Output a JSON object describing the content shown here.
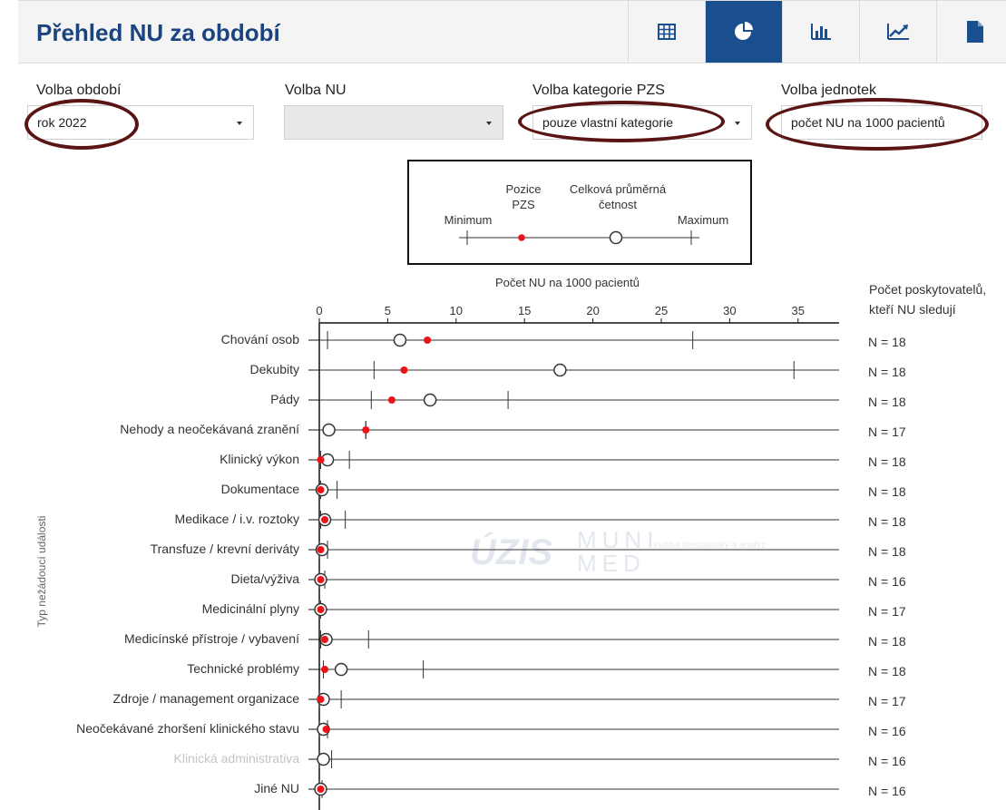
{
  "header": {
    "title": "Přehled NU za období",
    "views": [
      {
        "icon": "table-icon",
        "active": false
      },
      {
        "icon": "pie-chart-icon",
        "active": true
      },
      {
        "icon": "bar-chart-icon",
        "active": false
      },
      {
        "icon": "line-chart-icon",
        "active": false
      },
      {
        "icon": "document-icon",
        "active": false
      }
    ]
  },
  "filters": {
    "period": {
      "label": "Volba období",
      "value": "rok 2022"
    },
    "nu": {
      "label": "Volba NU",
      "value": ""
    },
    "category": {
      "label": "Volba kategorie PZS",
      "value": "pouze vlastní kategorie"
    },
    "units": {
      "label": "Volba jednotek",
      "value": "počet NU na 1000 pacientů"
    }
  },
  "legend": {
    "minimum": "Minimum",
    "position_line1": "Pozice",
    "position_line2": "PZS",
    "average_line1": "Celková průměrná",
    "average_line2": "četnost",
    "maximum": "Maximum"
  },
  "colors": {
    "accent": "#1a4f8f",
    "title": "#1a4480",
    "marker": "#e8141a",
    "highlight": "#5a1414"
  },
  "watermark": {
    "text1": "ÚZIS",
    "text2_line1": "MUNI",
    "text2_line2": "MED",
    "text3": "Institut biostatistiky a analýz"
  },
  "chart_data": {
    "type": "dot-range",
    "title": "Počet NU na 1000 pacientů",
    "ylabel": "Typ nežádoucí události",
    "right_title_line1": "Počet poskytovatelů,",
    "right_title_line2": "kteří NU sledují",
    "xlim": [
      0,
      38
    ],
    "xticks": [
      0,
      5,
      10,
      15,
      20,
      25,
      30,
      35
    ],
    "categories": [
      {
        "label": "Chování osob",
        "min": 0.6,
        "max": 27.3,
        "avg": 5.9,
        "pzs": 7.9,
        "n": "N = 18",
        "muted": false
      },
      {
        "label": "Dekubity",
        "min": 4.0,
        "max": 34.7,
        "avg": 17.6,
        "pzs": 6.2,
        "n": "N = 18",
        "muted": false
      },
      {
        "label": "Pády",
        "min": 3.8,
        "max": 13.8,
        "avg": 8.1,
        "pzs": 5.3,
        "n": "N = 18",
        "muted": false
      },
      {
        "label": "Nehody a neočekávaná zranění",
        "min": 3.4,
        "max": 3.4,
        "avg": 0.7,
        "pzs": 3.4,
        "n": "N = 17",
        "muted": false
      },
      {
        "label": "Klinický výkon",
        "min": 0.1,
        "max": 2.2,
        "avg": 0.6,
        "pzs": 0.1,
        "n": "N = 18",
        "muted": false
      },
      {
        "label": "Dokumentace",
        "min": 0.1,
        "max": 1.3,
        "avg": 0.2,
        "pzs": 0.1,
        "n": "N = 18",
        "muted": false
      },
      {
        "label": "Medikace / i.v. roztoky",
        "min": 0.1,
        "max": 1.9,
        "avg": 0.4,
        "pzs": 0.4,
        "n": "N = 18",
        "muted": false
      },
      {
        "label": "Transfuze / krevní deriváty",
        "min": 0.0,
        "max": 0.6,
        "avg": 0.2,
        "pzs": 0.1,
        "n": "N = 18",
        "muted": false
      },
      {
        "label": "Dieta/výživa",
        "min": 0.0,
        "max": 0.4,
        "avg": 0.1,
        "pzs": 0.1,
        "n": "N = 16",
        "muted": false
      },
      {
        "label": "Medicinální plyny",
        "min": 0.0,
        "max": 0.1,
        "avg": 0.1,
        "pzs": 0.1,
        "n": "N = 17",
        "muted": false
      },
      {
        "label": "Medicínské přístroje / vybavení",
        "min": 0.1,
        "max": 3.6,
        "avg": 0.5,
        "pzs": 0.4,
        "n": "N = 18",
        "muted": false
      },
      {
        "label": "Technické problémy",
        "min": 0.3,
        "max": 7.6,
        "avg": 1.6,
        "pzs": 0.4,
        "n": "N = 18",
        "muted": false
      },
      {
        "label": "Zdroje / management organizace",
        "min": 0.0,
        "max": 1.6,
        "avg": 0.3,
        "pzs": 0.1,
        "n": "N = 17",
        "muted": false
      },
      {
        "label": "Neočekávané zhoršení klinického stavu",
        "min": 0.0,
        "max": 0.6,
        "avg": 0.3,
        "pzs": 0.5,
        "n": "N = 16",
        "muted": false
      },
      {
        "label": "Klinická administrativa",
        "min": 0.0,
        "max": 0.9,
        "avg": 0.3,
        "pzs": null,
        "n": "N = 16",
        "muted": true
      },
      {
        "label": "Jiné NU",
        "min": 0.0,
        "max": 0.2,
        "avg": 0.1,
        "pzs": 0.1,
        "n": "N = 16",
        "muted": false
      }
    ]
  }
}
